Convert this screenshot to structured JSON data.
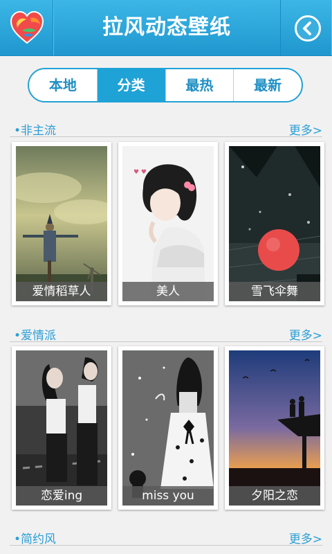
{
  "header": {
    "title": "拉风动态壁纸"
  },
  "tabs": [
    {
      "label": "本地",
      "active": false
    },
    {
      "label": "分类",
      "active": true
    },
    {
      "label": "最热",
      "active": false
    },
    {
      "label": "最新",
      "active": false
    }
  ],
  "sections": [
    {
      "title": "•非主流",
      "more": "更多>",
      "items": [
        {
          "caption": "爱情稻草人"
        },
        {
          "caption": "美人"
        },
        {
          "caption": "雪飞伞舞"
        }
      ]
    },
    {
      "title": "•爱情派",
      "more": "更多>",
      "items": [
        {
          "caption": "恋爱ing"
        },
        {
          "caption": "miss you"
        },
        {
          "caption": "夕阳之恋"
        }
      ]
    },
    {
      "title": "•简约风",
      "more": "更多>",
      "items": []
    }
  ],
  "colors": {
    "header_blue": "#1f97cf",
    "accent_blue": "#2a9fd6",
    "caption_bg": "#5a5a5a"
  },
  "icons": {
    "logo": "heart-logo-icon",
    "back": "back-arrow-icon"
  }
}
